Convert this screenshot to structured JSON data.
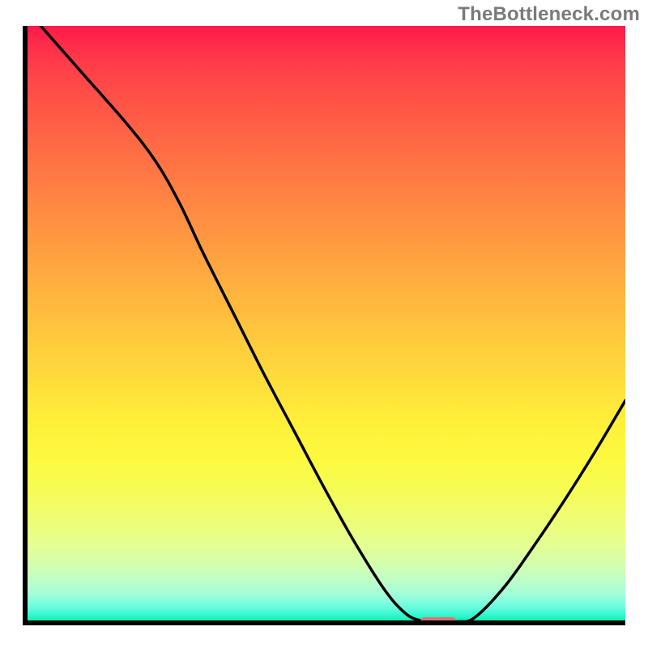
{
  "attribution": "TheBottleneck.com",
  "colors": {
    "gradient_top": "#ff1a49",
    "gradient_mid": "#ffdf3b",
    "gradient_bottom": "#00ec8f",
    "curve": "#000000",
    "marker": "#e06f77",
    "axis": "#000000"
  },
  "chart_data": {
    "type": "line",
    "title": "",
    "xlabel": "",
    "ylabel": "",
    "xlim": [
      0,
      100
    ],
    "ylim": [
      0,
      100
    ],
    "grid": false,
    "note": "Axes are unlabeled; x and y are normalized 0–100. Curve traced from pixels.",
    "x": [
      3,
      10,
      17,
      22,
      26,
      30,
      35,
      40,
      45,
      50,
      55,
      60,
      63.5,
      66,
      68,
      72,
      75,
      80,
      85,
      90,
      95,
      100
    ],
    "values": [
      100,
      92,
      84,
      77.5,
      70.5,
      62,
      52,
      42,
      32.5,
      23,
      14,
      6,
      2,
      0.8,
      0.6,
      0.6,
      1.3,
      6.5,
      13.5,
      21,
      29,
      37.5
    ],
    "marker": {
      "x_range": [
        66,
        72
      ],
      "y": 0.6
    },
    "background": "vertical red→yellow→green heat gradient"
  }
}
